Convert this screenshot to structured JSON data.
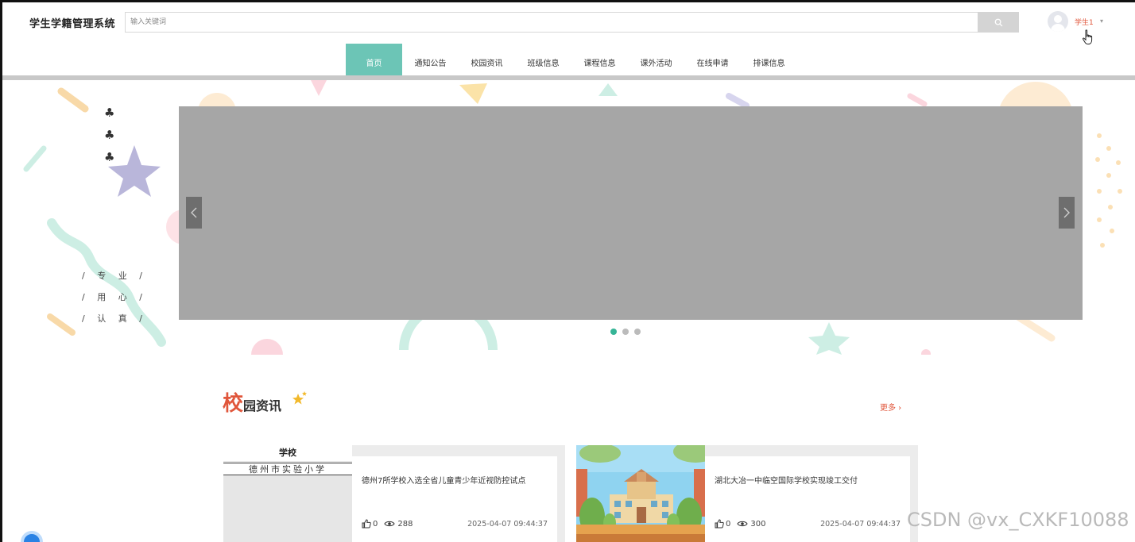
{
  "header": {
    "site_title": "学生学籍管理系统",
    "search_placeholder": "输入关键词",
    "user_name": "学生1",
    "user_caret": "▾"
  },
  "nav": {
    "items": [
      {
        "label": "首页",
        "color": "#1ab394",
        "active": true
      },
      {
        "label": "通知公告",
        "color": "#e46b5b"
      },
      {
        "label": "校园资讯",
        "color": "#f5c15b"
      },
      {
        "label": "班级信息",
        "color": "#2d8fd6"
      },
      {
        "label": "课程信息",
        "color": "#1ab394"
      },
      {
        "label": "课外活动",
        "color": "#e46b5b"
      },
      {
        "label": "在线申请",
        "color": "#f5c15b"
      },
      {
        "label": "排课信息",
        "color": "#2d8fd6"
      }
    ]
  },
  "hero": {
    "clubs": [
      "♣",
      "♣",
      "♣"
    ],
    "motto": [
      "/ 专 业 /",
      "/ 用 心 /",
      "/ 认 真 /"
    ],
    "carousel": {
      "slide_count": 3,
      "active_index": 0
    }
  },
  "news": {
    "section_title_big": "校",
    "section_title_rest": "园资讯",
    "more_label": "更多 ›",
    "cards": [
      {
        "thumb_line1": "学校",
        "thumb_line2": "德州市实验小学",
        "title": "德州7所学校入选全省儿童青少年近视防控试点",
        "likes": "0",
        "views": "288",
        "date": "2025-04-07 09:44:37"
      },
      {
        "title": "湖北大冶一中临空国际学校实现竣工交付",
        "likes": "0",
        "views": "300",
        "date": "2025-04-07 09:44:37"
      }
    ]
  },
  "watermark": "CSDN @vx_CXKF10088",
  "colors": {
    "accent": "#e0563b",
    "teal": "#35b496",
    "carousel": "#a6a6a6"
  }
}
